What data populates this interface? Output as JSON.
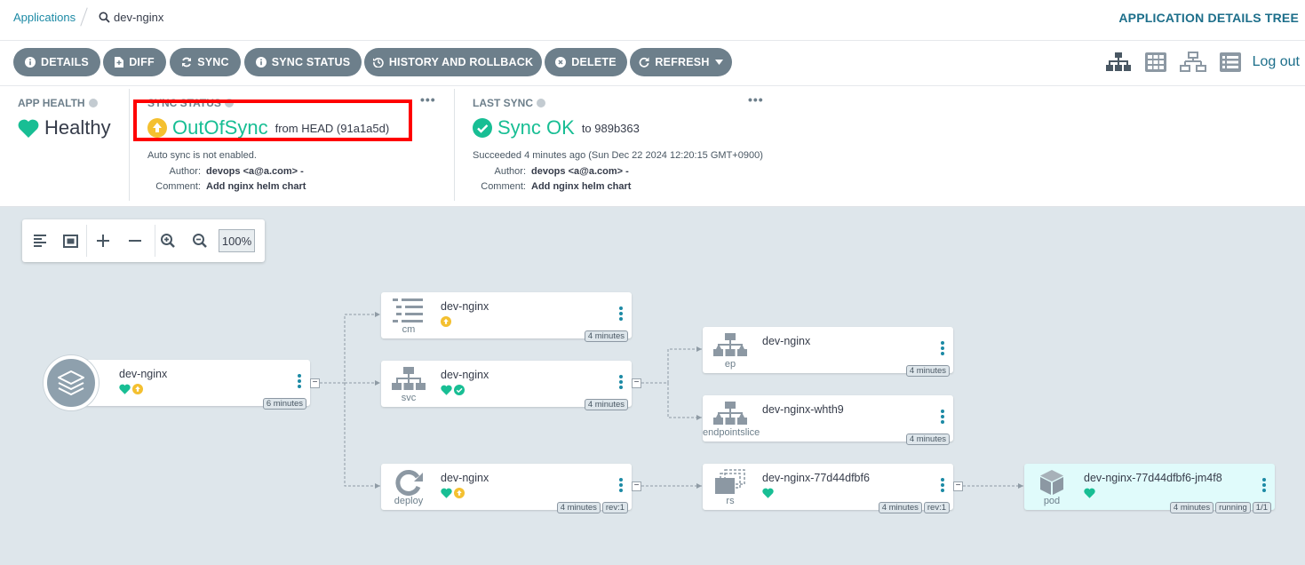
{
  "breadcrumb": {
    "applications": "Applications",
    "current": "dev-nginx"
  },
  "page_title": "APPLICATION DETAILS TREE",
  "toolbar": {
    "buttons": [
      {
        "label": "DETAILS",
        "icon": "info-icon"
      },
      {
        "label": "DIFF",
        "icon": "file-diff-icon"
      },
      {
        "label": "SYNC",
        "icon": "sync-icon"
      },
      {
        "label": "SYNC STATUS",
        "icon": "info-icon"
      },
      {
        "label": "HISTORY AND ROLLBACK",
        "icon": "history-icon"
      },
      {
        "label": "DELETE",
        "icon": "times-circle-icon"
      },
      {
        "label": "REFRESH",
        "icon": "redo-icon"
      }
    ],
    "logout": "Log out"
  },
  "app_health": {
    "title": "APP HEALTH",
    "value": "Healthy",
    "color": "#18be94"
  },
  "sync_status": {
    "title": "SYNC STATUS",
    "value": "OutOfSync",
    "from": "from HEAD (91a1a5d)",
    "auto_sync": "Auto sync is not enabled.",
    "author_label": "Author:",
    "author": "devops <a@a.com> -",
    "comment_label": "Comment:",
    "comment": "Add nginx helm chart",
    "color": "#f4c030"
  },
  "last_sync": {
    "title": "LAST SYNC",
    "value": "Sync OK",
    "to": "to 989b363",
    "succeeded": "Succeeded 4 minutes ago (Sun Dec 22 2024 12:20:15 GMT+0900)",
    "author_label": "Author:",
    "author": "devops <a@a.com> -",
    "comment_label": "Comment:",
    "comment": "Add nginx helm chart",
    "color": "#18be94"
  },
  "zoom": {
    "value": "100%"
  },
  "nodes": {
    "app": {
      "name": "dev-nginx",
      "age": "6 minutes"
    },
    "cm": {
      "name": "dev-nginx",
      "kind": "cm",
      "age": "4 minutes"
    },
    "svc": {
      "name": "dev-nginx",
      "kind": "svc",
      "age": "4 minutes"
    },
    "deploy": {
      "name": "dev-nginx",
      "kind": "deploy",
      "age": "4 minutes",
      "rev": "rev:1"
    },
    "ep": {
      "name": "dev-nginx",
      "kind": "ep",
      "age": "4 minutes"
    },
    "eps": {
      "name": "dev-nginx-whth9",
      "kind": "endpointslice",
      "age": "4 minutes"
    },
    "rs": {
      "name": "dev-nginx-77d44dfbf6",
      "kind": "rs",
      "age": "4 minutes",
      "rev": "rev:1"
    },
    "pod": {
      "name": "dev-nginx-77d44dfbf6-jm4f8",
      "kind": "pod",
      "age": "4 minutes",
      "status": "running",
      "ready": "1/1"
    }
  }
}
